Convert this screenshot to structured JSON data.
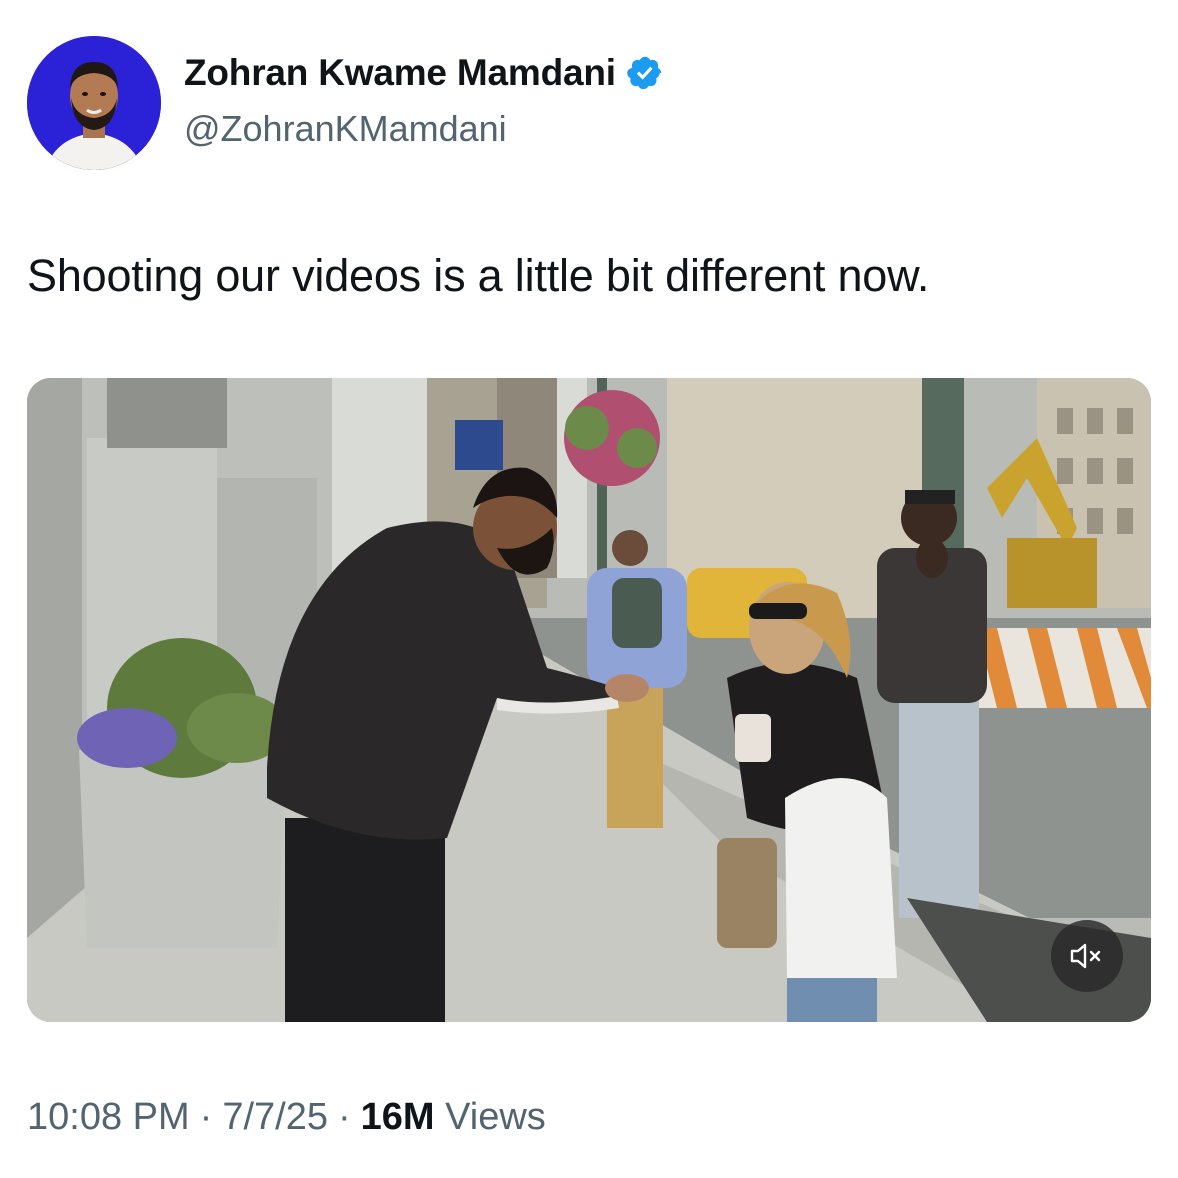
{
  "author": {
    "display_name": "Zohran Kwame Mamdani",
    "handle": "@ZohranKMamdani",
    "verified": true,
    "avatar_bg": "#2b22d8",
    "verified_color": "#1d9bf0"
  },
  "tweet": {
    "text": "Shooting our videos is a little bit different now."
  },
  "media": {
    "type": "video",
    "mute_icon": "speaker-muted-icon"
  },
  "meta": {
    "time": "10:08 PM",
    "separator": "·",
    "date": "7/7/25",
    "views_count": "16M",
    "views_label": "Views"
  }
}
